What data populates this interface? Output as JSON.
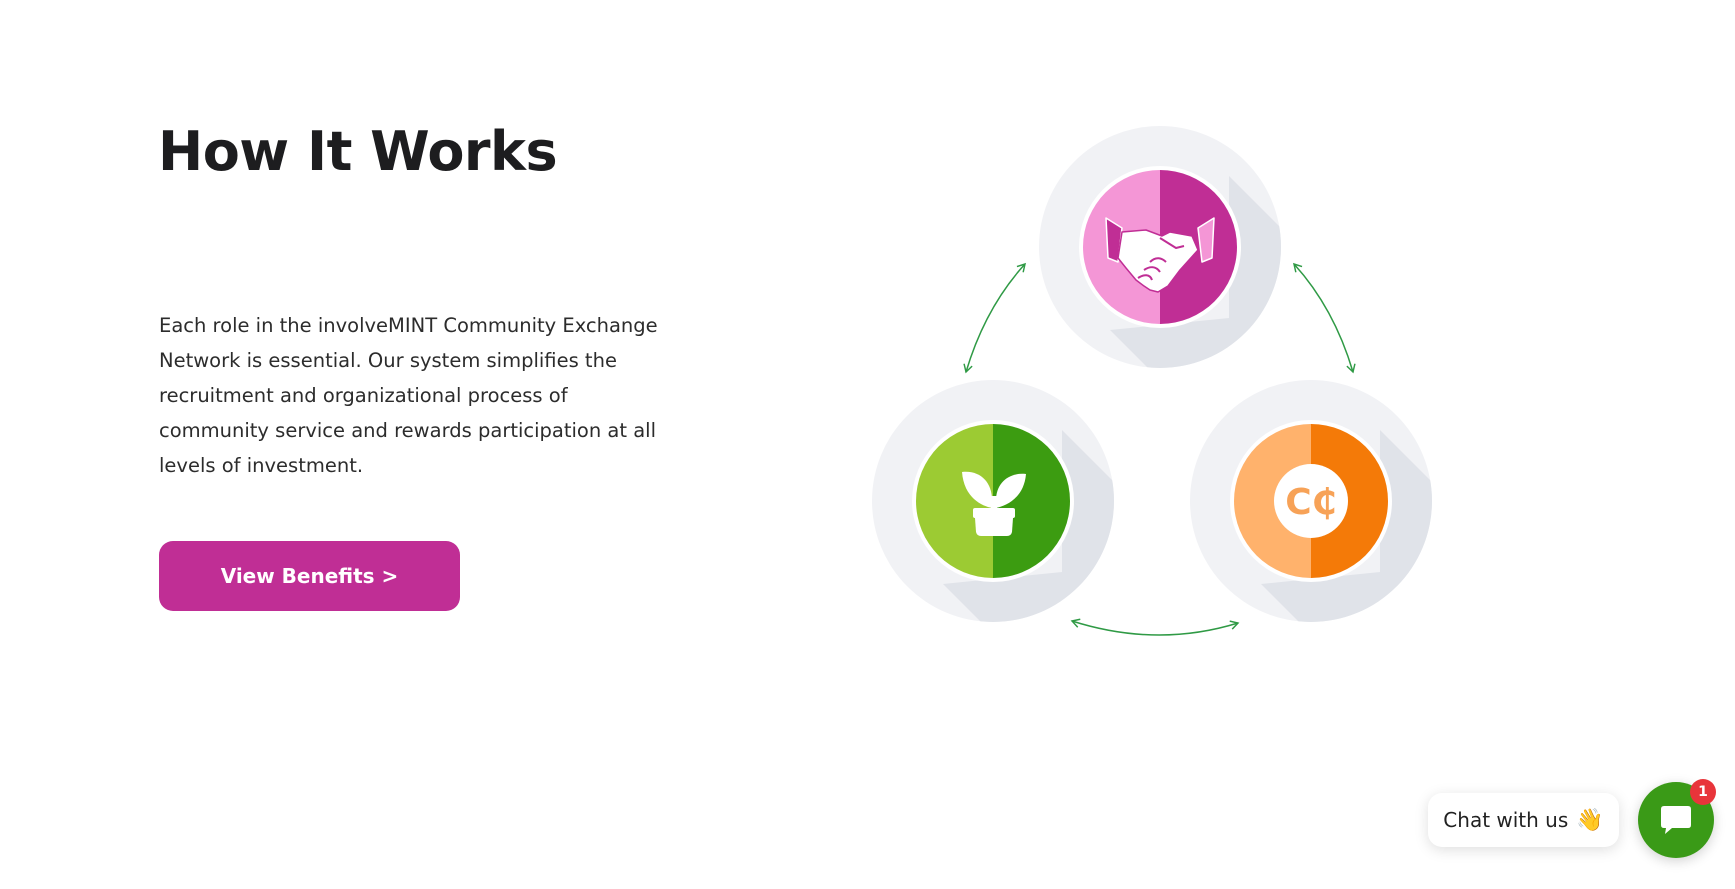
{
  "section": {
    "title": "How It Works",
    "description": "Each role in the involveMINT Community Exchange Network is essential. Our system simplifies the recruitment and organizational process of community service and rewards participation at all levels of investment.",
    "button_label": "View Benefits >"
  },
  "diagram": {
    "nodes": [
      {
        "icon": "handshake-icon",
        "colors": [
          "#f496d6",
          "#c02e95"
        ]
      },
      {
        "icon": "plant-icon",
        "colors": [
          "#9ccb33",
          "#3c9c11"
        ]
      },
      {
        "icon": "coin-icon",
        "label": "C₵",
        "colors": [
          "#ffb26c",
          "#f47a08"
        ]
      }
    ],
    "arrow_color": "#2f9a45"
  },
  "chat": {
    "label": "Chat with us",
    "emoji": "👋",
    "badge_count": "1"
  }
}
